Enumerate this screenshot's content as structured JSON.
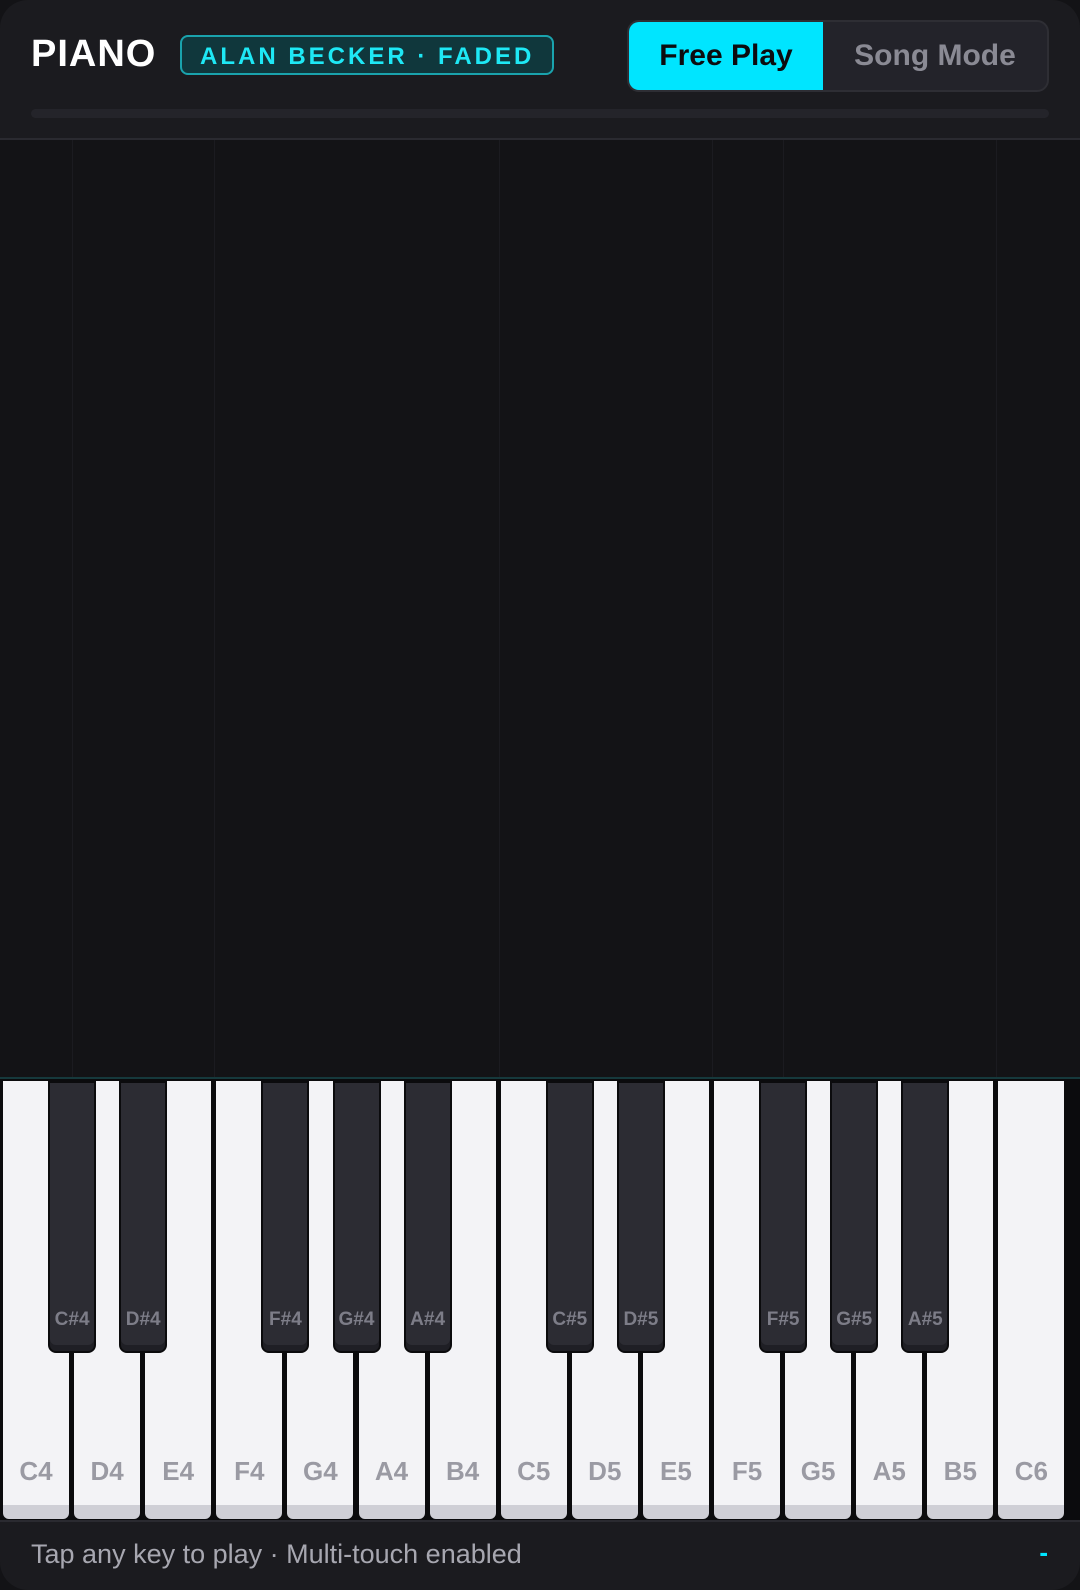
{
  "header": {
    "title": "PIANO",
    "badge": "ALAN BECKER · FADED",
    "modes": [
      {
        "label": "Free Play",
        "active": true
      },
      {
        "label": "Song Mode",
        "active": false
      }
    ],
    "song_progress": 0
  },
  "keyboard": {
    "white_keys": [
      "C4",
      "D4",
      "E4",
      "F4",
      "G4",
      "A4",
      "B4",
      "C5",
      "D5",
      "E5",
      "F5",
      "G5",
      "A5",
      "B5",
      "C6"
    ],
    "black_keys": [
      "C#4",
      "D#4",
      "F#4",
      "G#4",
      "A#4",
      "C#5",
      "D#5",
      "F#5",
      "G#5",
      "A#5"
    ]
  },
  "footer": {
    "hint": "Tap any key to play · Multi-touch enabled",
    "status": "-"
  },
  "colors": {
    "accent": "#00e5ff",
    "background": "#131316",
    "white_key": "#f3f3f6",
    "black_key": "#2c2c33"
  }
}
